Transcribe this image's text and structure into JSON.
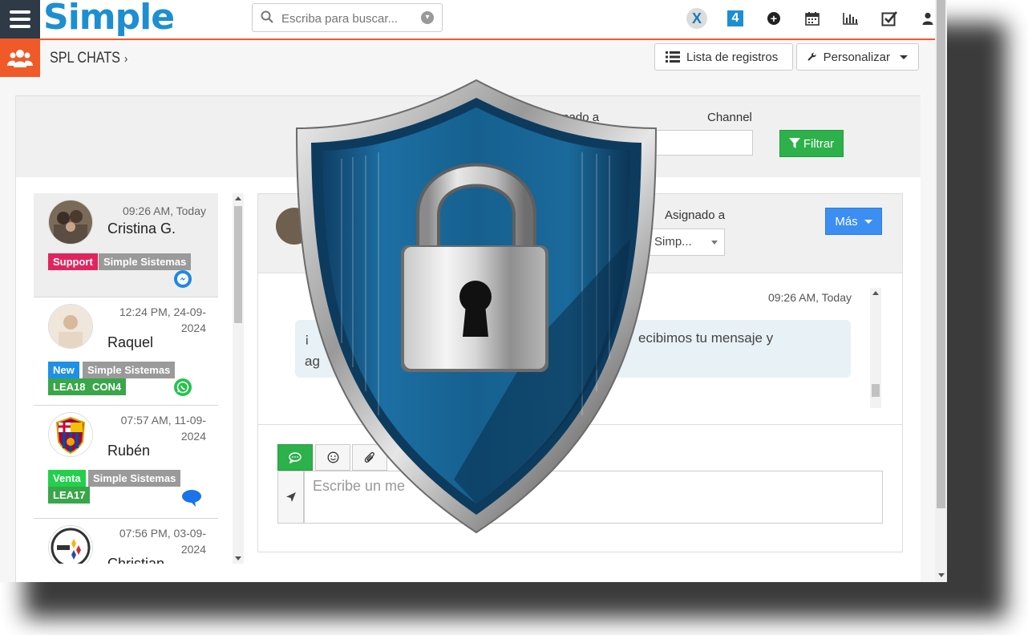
{
  "app": {
    "logo": "Simple"
  },
  "search": {
    "placeholder": "Escriba para buscar..."
  },
  "topnav": {
    "icons": [
      "x-app-icon",
      "four-app-icon",
      "plus-circle-icon",
      "calendar-icon",
      "bar-chart-icon",
      "checkbox-icon",
      "user-icon"
    ],
    "four_label": "4",
    "x_label": "X"
  },
  "breadcrumb": {
    "title": "SPL CHATS",
    "chevron": "›"
  },
  "toolbar": {
    "list_label": "Lista de registros",
    "customize_label": "Personalizar"
  },
  "filters": {
    "assigned_label": "Asignado a",
    "channel_label": "Channel",
    "filter_button": "Filtrar",
    "assigned_partial": "signado a"
  },
  "chats": [
    {
      "time": "09:26 AM, Today",
      "name": "Cristina G.",
      "tags": [
        "Support",
        "Simple Sistemas"
      ],
      "channel": "messenger"
    },
    {
      "time_line1": "12:24 PM, 24-09-",
      "time_line2": "2024",
      "name": "Raquel",
      "tags": [
        "New",
        "Simple Sistemas",
        "LEA18",
        "CON4"
      ],
      "channel": "whatsapp"
    },
    {
      "time_line1": "07:57 AM, 11-09-",
      "time_line2": "2024",
      "name": "Rubén",
      "tags": [
        "Venta",
        "Simple Sistemas",
        "LEA17"
      ],
      "channel": "chat-bubble"
    },
    {
      "time_line1": "07:56 PM, 03-09-",
      "time_line2": "2024",
      "name": "Christian",
      "tags": [],
      "channel": ""
    }
  ],
  "conversation": {
    "assigned_label": "Asignado a",
    "assigned_value": "Simp...",
    "more_button": "Más",
    "message_time": "09:26 AM, Today",
    "message_part1": "¡",
    "message_part2": "ecibimos tu mensaje y",
    "message_line2": "ag",
    "composer_placeholder": "Escribe un me"
  },
  "colors": {
    "accent": "#f05a28",
    "brand": "#1d8fd1",
    "green": "#2db14a",
    "blue": "#3c8ef3"
  }
}
